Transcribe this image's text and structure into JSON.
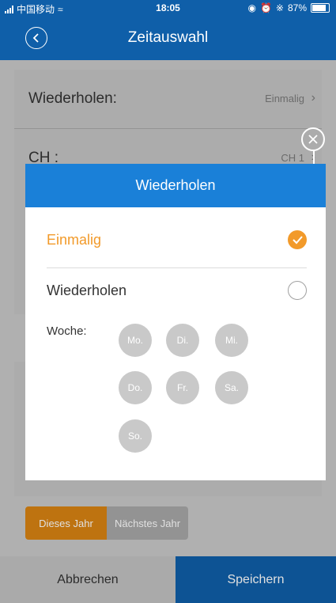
{
  "status_bar": {
    "carrier": "中国移动",
    "time": "18:05",
    "battery": "87%"
  },
  "header": {
    "title": "Zeitauswahl"
  },
  "settings": {
    "repeat_label": "Wiederholen:",
    "repeat_value": "Einmalig",
    "channel_label": "CH :",
    "channel_value": "CH 1"
  },
  "modal": {
    "title": "Wiederholen",
    "options": [
      {
        "label": "Einmalig",
        "selected": true
      },
      {
        "label": "Wiederholen",
        "selected": false
      }
    ],
    "week_label": "Woche:",
    "days": [
      "Mo.",
      "Di.",
      "Mi.",
      "Do.",
      "Fr.",
      "Sa.",
      "So."
    ]
  },
  "year_toggle": {
    "this_year": "Dieses Jahr",
    "next_year": "Nächstes Jahr"
  },
  "footer": {
    "cancel": "Abbrechen",
    "save": "Speichern"
  },
  "colors": {
    "primary": "#0f5fa9",
    "modal_header": "#1a80d8",
    "accent": "#f29a2a",
    "toggle_active": "#d98313"
  }
}
